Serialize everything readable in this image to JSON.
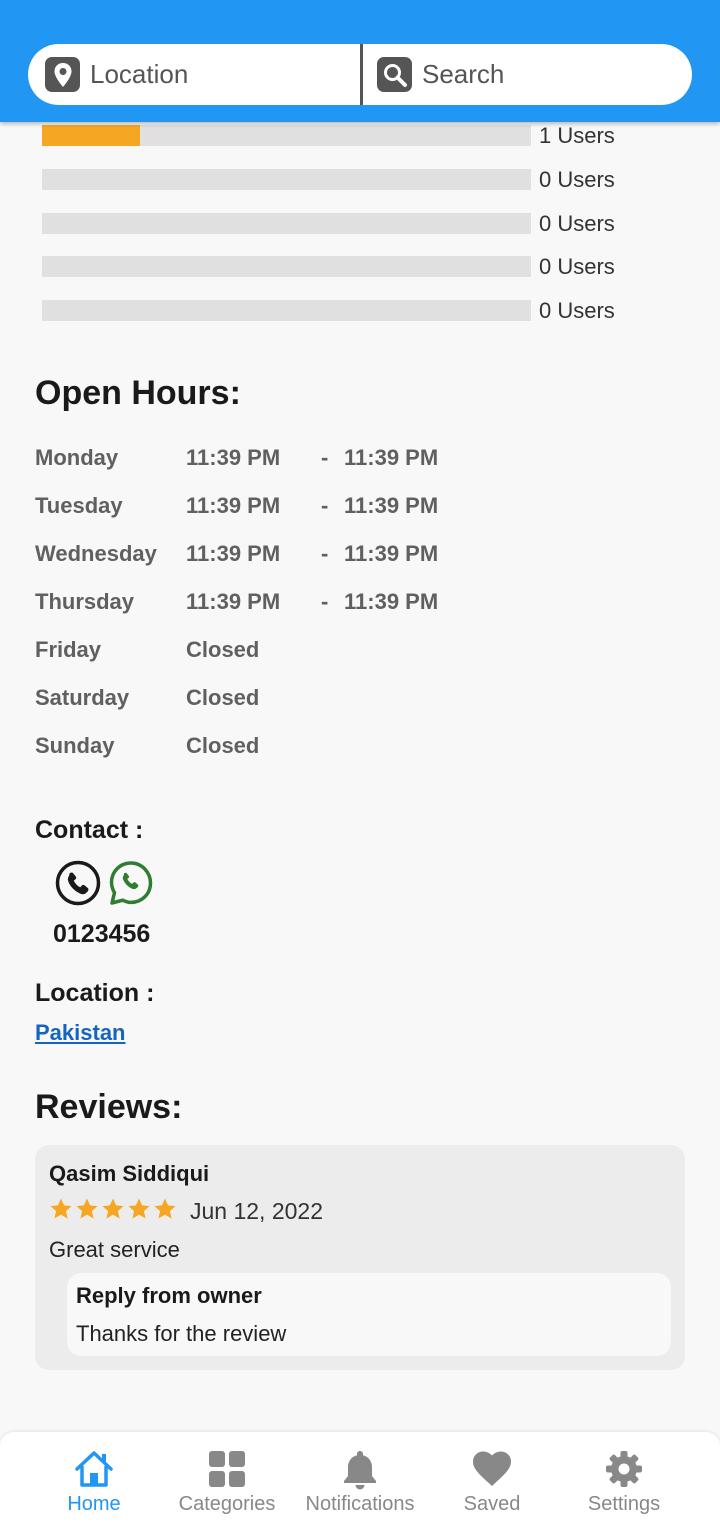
{
  "header": {
    "location_label": "Location",
    "search_label": "Search"
  },
  "rating_bars": [
    {
      "count_label": "1 Users",
      "fill": 0.2
    },
    {
      "count_label": "0 Users",
      "fill": 0
    },
    {
      "count_label": "0 Users",
      "fill": 0
    },
    {
      "count_label": "0 Users",
      "fill": 0
    },
    {
      "count_label": "0 Users",
      "fill": 0
    }
  ],
  "open_hours": {
    "title": "Open Hours:",
    "days": [
      {
        "day": "Monday",
        "open": "11:39 PM",
        "dash": "-",
        "close": "11:39 PM"
      },
      {
        "day": "Tuesday",
        "open": "11:39 PM",
        "dash": "-",
        "close": "11:39 PM"
      },
      {
        "day": "Wednesday",
        "open": "11:39 PM",
        "dash": "-",
        "close": "11:39 PM"
      },
      {
        "day": "Thursday",
        "open": "11:39 PM",
        "dash": "-",
        "close": "11:39 PM"
      },
      {
        "day": "Friday",
        "open": "Closed"
      },
      {
        "day": "Saturday",
        "open": "Closed"
      },
      {
        "day": "Sunday",
        "open": "Closed"
      }
    ]
  },
  "contact": {
    "title": "Contact :",
    "phone_number": "0123456"
  },
  "location": {
    "title": "Location :",
    "value": "Pakistan"
  },
  "reviews": {
    "title": "Reviews:",
    "items": [
      {
        "reviewer": "Qasim Siddiqui",
        "rating": 5,
        "date": "Jun 12, 2022",
        "text": "Great service",
        "reply_title": "Reply from owner",
        "reply_text": "Thanks for the review"
      }
    ]
  },
  "bottom_nav": [
    {
      "label": "Home",
      "icon": "home-icon",
      "active": true
    },
    {
      "label": "Categories",
      "icon": "grid-icon",
      "active": false
    },
    {
      "label": "Notifications",
      "icon": "bell-icon",
      "active": false
    },
    {
      "label": "Saved",
      "icon": "heart-icon",
      "active": false
    },
    {
      "label": "Settings",
      "icon": "gear-icon",
      "active": false
    }
  ],
  "colors": {
    "primary": "#2196f3",
    "rating_fill": "#f5a623",
    "star": "#f5a623",
    "link": "#1565c0",
    "whatsapp": "#2e7d32"
  }
}
